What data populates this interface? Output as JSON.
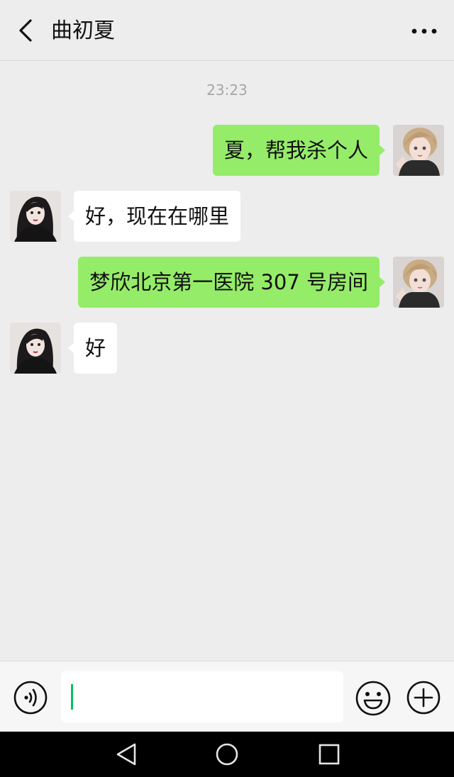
{
  "header": {
    "title": "曲初夏",
    "back_icon": "chevron-left-icon",
    "more_icon": "more-dots-icon"
  },
  "chat": {
    "timestamp": "23:23",
    "messages": [
      {
        "side": "right",
        "text": "夏，帮我杀个人"
      },
      {
        "side": "left",
        "text": "好，现在在哪里"
      },
      {
        "side": "right",
        "text": "梦欣北京第一医院 307 号房间"
      },
      {
        "side": "left",
        "text": "好"
      }
    ]
  },
  "input_bar": {
    "value": "",
    "placeholder": "",
    "icons": [
      "voice-icon",
      "emoji-icon",
      "plus-icon"
    ]
  },
  "colors": {
    "sent_bubble": "#95ec69",
    "received_bubble": "#ffffff",
    "background": "#ededed",
    "caret": "#07c160"
  }
}
